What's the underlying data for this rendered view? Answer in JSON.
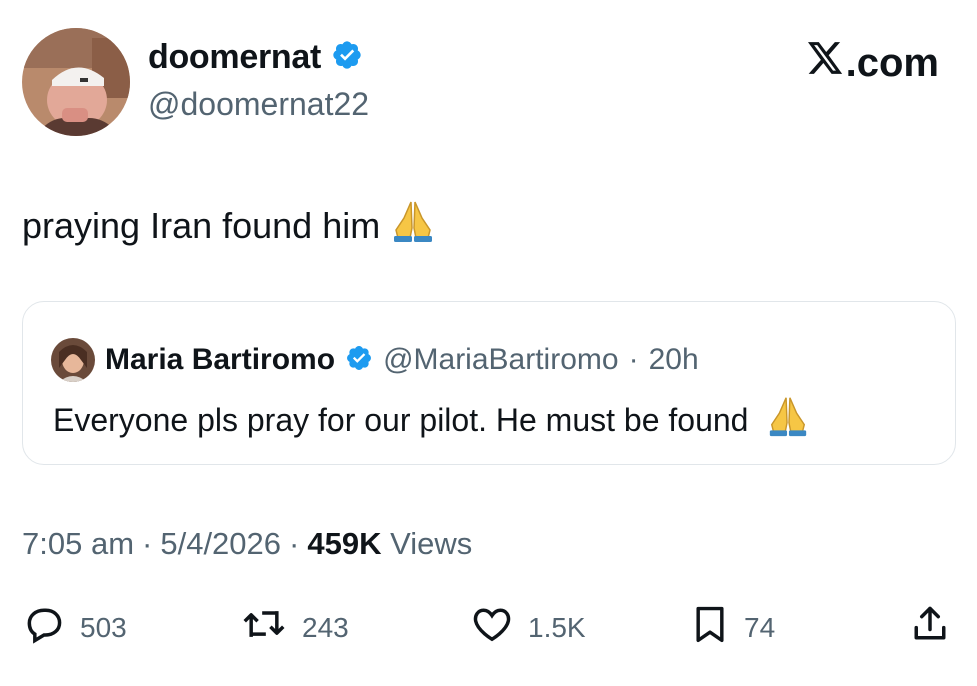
{
  "author": {
    "display_name": "doomernat",
    "handle": "@doomernat22",
    "verified_icon": "verified-badge-icon"
  },
  "brand": {
    "text": ".com",
    "logo_icon": "x-logo-icon"
  },
  "tweet": {
    "text": "praying Iran found him",
    "emoji_icon": "folded-hands-icon"
  },
  "quote": {
    "display_name": "Maria Bartiromo",
    "handle": "@MariaBartiromo",
    "separator": "·",
    "time": "20h",
    "text": "Everyone pls pray for our pilot. He must be found",
    "emoji_icon": "folded-hands-icon"
  },
  "meta": {
    "time": "7:05 am",
    "sep1": "·",
    "date": "5/4/2026",
    "sep2": "·",
    "views_count": "459K",
    "views_label": "Views"
  },
  "actions": {
    "replies": "503",
    "retweets": "243",
    "likes": "1.5K",
    "bookmarks": "74"
  },
  "colors": {
    "verified": "#1d9bf0",
    "secondary_text": "#536471",
    "primary_text": "#0f1419"
  }
}
